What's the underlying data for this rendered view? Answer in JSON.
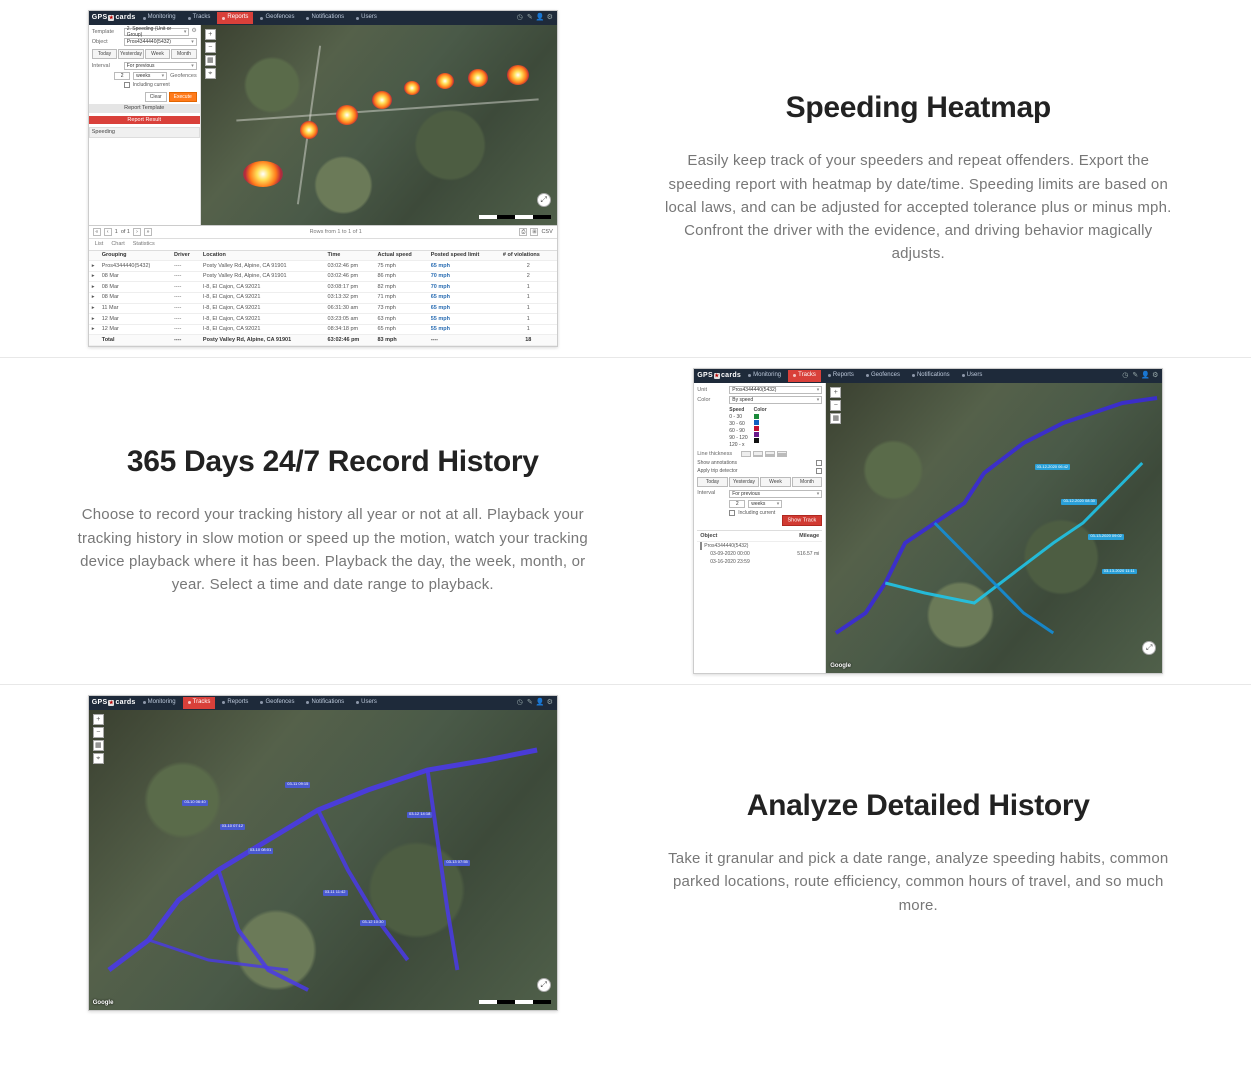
{
  "sections": [
    {
      "title": "Speeding Heatmap",
      "desc": "Easily keep track of your speeders and repeat offenders. Export the speeding report with heatmap by date/time. Speeding limits are based on local laws, and can be adjusted for accepted tolerance plus or minus mph. Confront the driver with the evidence, and driving behavior magically adjusts."
    },
    {
      "title": "365 Days 24/7 Record History",
      "desc": "Choose to record your tracking history all year or not at all. Playback your tracking history in slow motion or speed up the motion, watch your tracking device playback where it has been. Playback the day, the week, month, or year. Select a time and date range to playback."
    },
    {
      "title": "Analyze Detailed History",
      "desc": "Take it granular and pick a date range, analyze speeding habits, common parked locations, route efficiency, common hours of travel, and so much more."
    }
  ],
  "app": {
    "brand": "GPS",
    "brand2": "cards",
    "tabs": [
      "Monitoring",
      "Tracks",
      "Reports",
      "Geofences",
      "Notifications",
      "Users"
    ],
    "template_label": "Template",
    "template_value": "2. Speeding (Unit or Group)",
    "object_label": "Object",
    "object_value": "Pros4344440(5432)",
    "interval_label": "Interval",
    "interval_value": "For previous",
    "interval_amount": "2",
    "interval_unit": "weeks",
    "range_today": "Today",
    "range_yesterday": "Yesterday",
    "range_week": "Week",
    "range_month": "Month",
    "including_current": "Including current",
    "geofences_label": "Geofences",
    "clear": "Clear",
    "execute": "Execute",
    "report_template": "Report Template",
    "report_result": "Report Result",
    "speeding_section": "Speeding",
    "pager_of": "of 1",
    "pager_rows": "Rows from 1 to 1 of 1",
    "pager_csv": "CSV",
    "tabs_list": "List",
    "tabs_chart": "Chart",
    "tabs_stats": "Statistics",
    "cols": {
      "grouping": "Grouping",
      "driver": "Driver",
      "location": "Location",
      "time": "Time",
      "actual": "Actual speed",
      "posted": "Posted speed limit",
      "viol": "# of violations"
    },
    "rows": [
      {
        "g": "Pros4344440(5432)",
        "d": "----",
        "l": "Posty Valley Rd, Alpine, CA 91901",
        "t": "03:02:46 pm",
        "as": "75 mph",
        "ps": "65 mph",
        "v": "2"
      },
      {
        "g": "08 Mar",
        "d": "----",
        "l": "Posty Valley Rd, Alpine, CA 91901",
        "t": "03:02:46 pm",
        "as": "86 mph",
        "ps": "70 mph",
        "v": "2"
      },
      {
        "g": "08 Mar",
        "d": "----",
        "l": "I-8, El Cajon, CA 92021",
        "t": "03:08:17 pm",
        "as": "82 mph",
        "ps": "70 mph",
        "v": "1"
      },
      {
        "g": "08 Mar",
        "d": "----",
        "l": "I-8, El Cajon, CA 92021",
        "t": "03:13:32 pm",
        "as": "71 mph",
        "ps": "65 mph",
        "v": "1"
      },
      {
        "g": "11 Mar",
        "d": "----",
        "l": "I-8, El Cajon, CA 92021",
        "t": "06:31:30 am",
        "as": "73 mph",
        "ps": "65 mph",
        "v": "1"
      },
      {
        "g": "12 Mar",
        "d": "----",
        "l": "I-8, El Cajon, CA 92021",
        "t": "03:23:05 am",
        "as": "63 mph",
        "ps": "55 mph",
        "v": "1"
      },
      {
        "g": "12 Mar",
        "d": "----",
        "l": "I-8, El Cajon, CA 92021",
        "t": "08:34:18 pm",
        "as": "65 mph",
        "ps": "55 mph",
        "v": "1"
      }
    ],
    "foot": {
      "g": "Total",
      "d": "----",
      "l": "Posty Valley Rd, Alpine, CA 91901",
      "t": "63:02:46 pm",
      "as": "83 mph",
      "ps": "----",
      "v": "18"
    }
  },
  "app2": {
    "unit_label": "Unit",
    "unit_value": "Pros4344440(5432)",
    "color_label": "Color",
    "color_value": "By speed",
    "speed_h": "Speed",
    "color_h": "Color",
    "ranges": [
      {
        "r": "0 - 30",
        "c": "#1b8a3a"
      },
      {
        "r": "30 - 60",
        "c": "#1060c0"
      },
      {
        "r": "60 - 90",
        "c": "#c01030"
      },
      {
        "r": "90 - 120",
        "c": "#6a1a8a"
      },
      {
        "r": "120 - x",
        "c": "#101010"
      }
    ],
    "linew_label": "Line thickness",
    "show_ann": "Show annotations",
    "apply_det": "Apply trip detector",
    "show_track": "Show Track",
    "list_hdr_obj": "Object",
    "list_hdr_mi": "Mileage",
    "rows": [
      {
        "n": "Pros4344440(5432)",
        "m": ""
      },
      {
        "n": "03-09-2020  00:00",
        "m": "516.57 mi"
      },
      {
        "n": "03-16-2020  23:59",
        "m": ""
      }
    ]
  },
  "google": "Google"
}
